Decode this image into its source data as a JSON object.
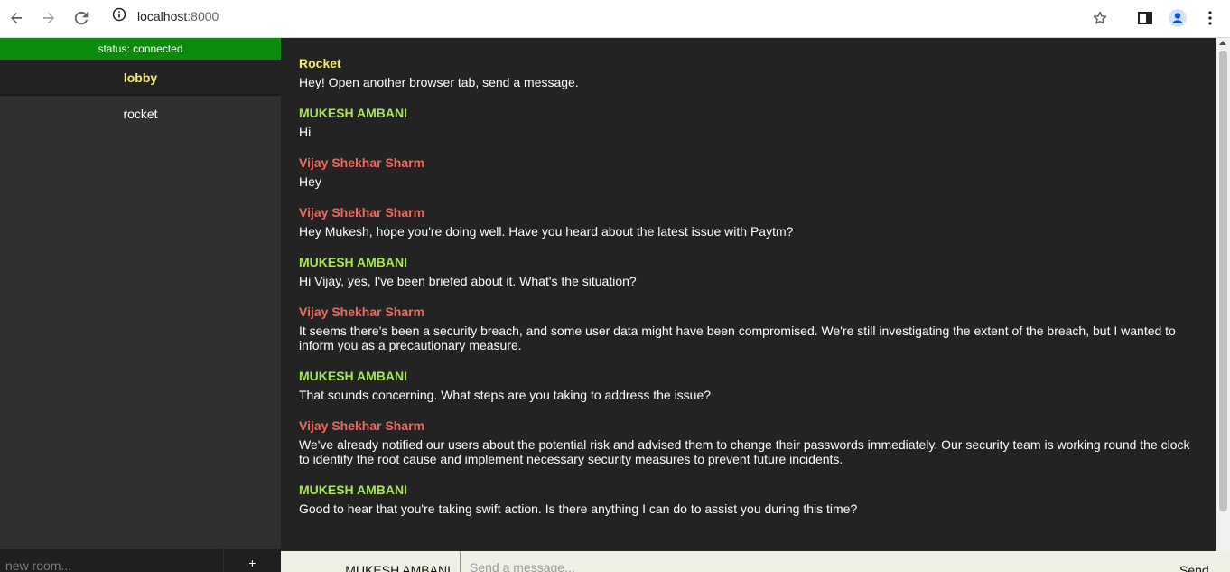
{
  "browser": {
    "url_host": "localhost",
    "url_port": ":8000"
  },
  "sidebar": {
    "status": "status: connected",
    "rooms": [
      {
        "label": "lobby",
        "active": true
      },
      {
        "label": "rocket",
        "active": false
      }
    ],
    "new_room_placeholder": "new room...",
    "add_room_label": "+"
  },
  "messages": [
    {
      "author": "Rocket",
      "color": "#f3ea6e",
      "text": "Hey! Open another browser tab, send a message."
    },
    {
      "author": "MUKESH AMBANI",
      "color": "#a8e55a",
      "text": "Hi"
    },
    {
      "author": "Vijay Shekhar Sharm",
      "color": "#f06a5e",
      "text": "Hey"
    },
    {
      "author": "Vijay Shekhar Sharm",
      "color": "#f06a5e",
      "text": "Hey Mukesh, hope you're doing well. Have you heard about the latest issue with Paytm?"
    },
    {
      "author": "MUKESH AMBANI",
      "color": "#a8e55a",
      "text": "Hi Vijay, yes, I've been briefed about it. What's the situation?"
    },
    {
      "author": "Vijay Shekhar Sharm",
      "color": "#f06a5e",
      "text": "It seems there's been a security breach, and some user data might have been compromised. We're still investigating the extent of the breach, but I wanted to inform you as a precautionary measure."
    },
    {
      "author": "MUKESH AMBANI",
      "color": "#a8e55a",
      "text": "That sounds concerning. What steps are you taking to address the issue?"
    },
    {
      "author": "Vijay Shekhar Sharm",
      "color": "#f06a5e",
      "text": "We've already notified our users about the potential risk and advised them to change their passwords immediately. Our security team is working round the clock to identify the root cause and implement necessary security measures to prevent future incidents."
    },
    {
      "author": "MUKESH AMBANI",
      "color": "#a8e55a",
      "text": "Good to hear that you're taking swift action. Is there anything I can do to assist you during this time?"
    }
  ],
  "composer": {
    "username": "MUKESH AMBANI",
    "message_placeholder": "Send a message...",
    "send_label": "Send"
  }
}
